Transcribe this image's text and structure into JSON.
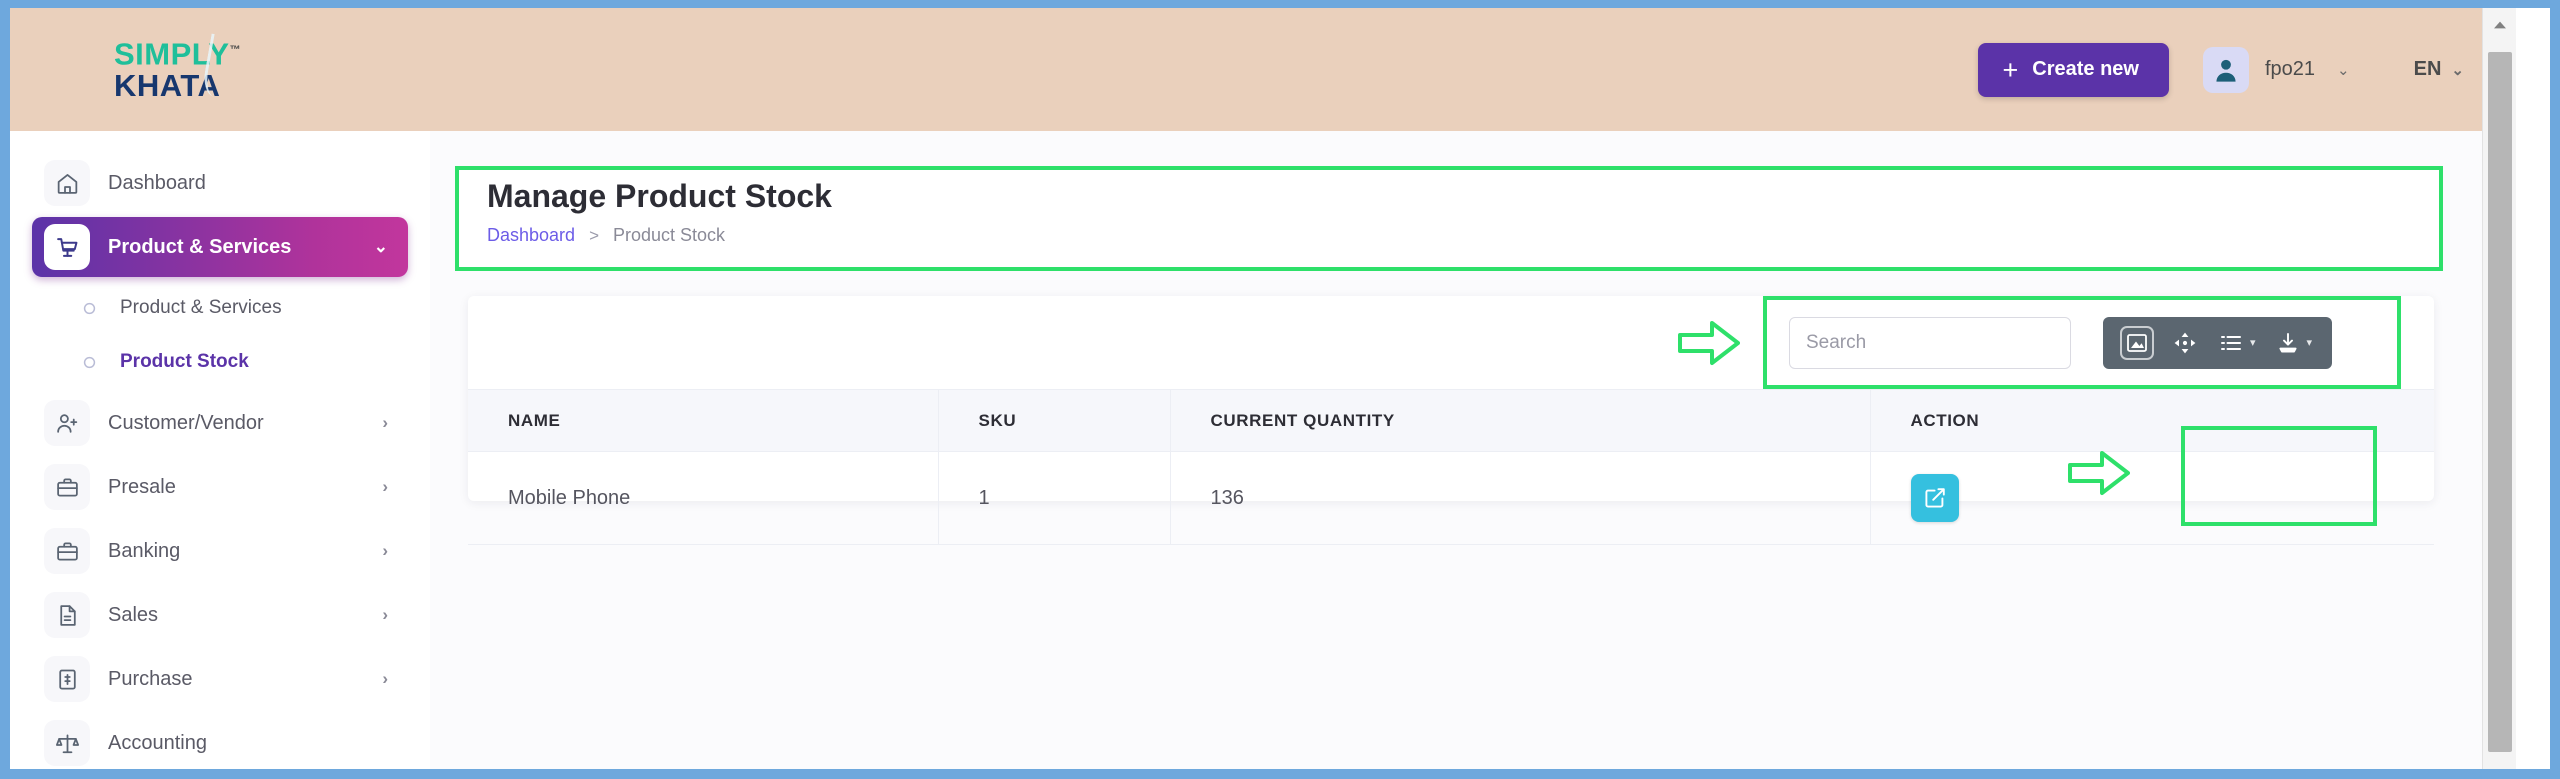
{
  "brand": {
    "logo_line1": "SIMPLY",
    "logo_trademark": "™",
    "logo_line2": "KHATA"
  },
  "topbar": {
    "create_new_label": "Create new",
    "plus_icon": "plus-icon",
    "user_name": "fpo21",
    "user_caret": "⌄",
    "language": "EN",
    "language_caret": "⌄"
  },
  "sidebar": {
    "items": [
      {
        "label": "Dashboard",
        "icon": "home-icon",
        "active": false,
        "chevron": ""
      },
      {
        "label": "Product & Services",
        "icon": "shopping-cart-icon",
        "active": true,
        "chevron": "⌄"
      },
      {
        "label": "Customer/Vendor",
        "icon": "user-add-icon",
        "active": false,
        "chevron": "›"
      },
      {
        "label": "Presale",
        "icon": "briefcase-icon",
        "active": false,
        "chevron": "›"
      },
      {
        "label": "Banking",
        "icon": "briefcase-icon",
        "active": false,
        "chevron": "›"
      },
      {
        "label": "Sales",
        "icon": "file-icon",
        "active": false,
        "chevron": "›"
      },
      {
        "label": "Purchase",
        "icon": "clipboard-icon",
        "active": false,
        "chevron": "›"
      },
      {
        "label": "Accounting",
        "icon": "scale-icon",
        "active": false,
        "chevron": ""
      }
    ],
    "sub_items": [
      {
        "label": "Product & Services",
        "current": false
      },
      {
        "label": "Product Stock",
        "current": true
      }
    ]
  },
  "page": {
    "title": "Manage Product Stock",
    "breadcrumb": {
      "root": "Dashboard",
      "separator": ">",
      "current": "Product Stock"
    }
  },
  "search": {
    "placeholder": "Search",
    "value": ""
  },
  "table_toolbar": {
    "buttons": [
      {
        "name": "print-image-icon",
        "caret": ""
      },
      {
        "name": "fullscreen-move-icon",
        "caret": ""
      },
      {
        "name": "column-list-icon",
        "caret": "▾"
      },
      {
        "name": "export-download-icon",
        "caret": "▾"
      }
    ]
  },
  "table": {
    "columns": [
      "NAME",
      "SKU",
      "CURRENT QUANTITY",
      "ACTION"
    ],
    "rows": [
      {
        "name": "Mobile Phone",
        "sku": "1",
        "current_quantity": "136",
        "action_icon": "edit-icon"
      }
    ]
  },
  "annotations": {
    "color": "#2ee06a",
    "arrow_search": "right-arrow-annotation",
    "arrow_action": "right-arrow-annotation",
    "box_title": "title-highlight-box",
    "box_search": "search-highlight-box",
    "box_action": "action-highlight-box"
  },
  "colors": {
    "header_bg": "#ead0bc",
    "accent_purple": "#5b33a8",
    "accent_magenta": "#c2369d",
    "edit_button": "#35c0df",
    "toolbar_bg": "#5b6670",
    "annotation_green": "#2ee06a",
    "browser_frame": "#6ea8dd"
  }
}
